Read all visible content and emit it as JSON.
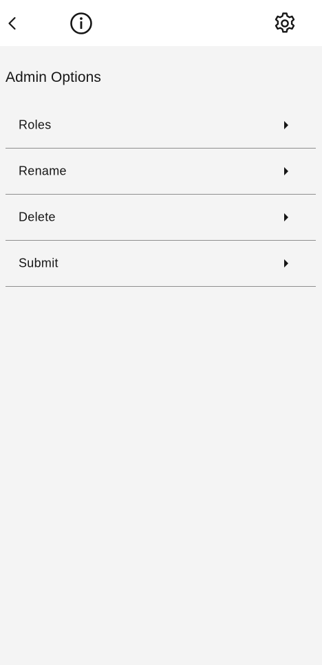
{
  "header": {
    "back_icon": "chevron-left-icon",
    "info_icon": "info-icon",
    "settings_icon": "gear-icon"
  },
  "section": {
    "title": "Admin Options"
  },
  "menu": {
    "items": [
      {
        "label": "Roles",
        "icon": "caret-right-icon"
      },
      {
        "label": "Rename",
        "icon": "caret-right-icon"
      },
      {
        "label": "Delete",
        "icon": "caret-right-icon"
      },
      {
        "label": "Submit",
        "icon": "caret-right-icon"
      }
    ]
  },
  "colors": {
    "header_bg": "#ffffff",
    "page_bg": "#f4f4f4",
    "text": "#161616",
    "divider": "#8d8d8d"
  }
}
